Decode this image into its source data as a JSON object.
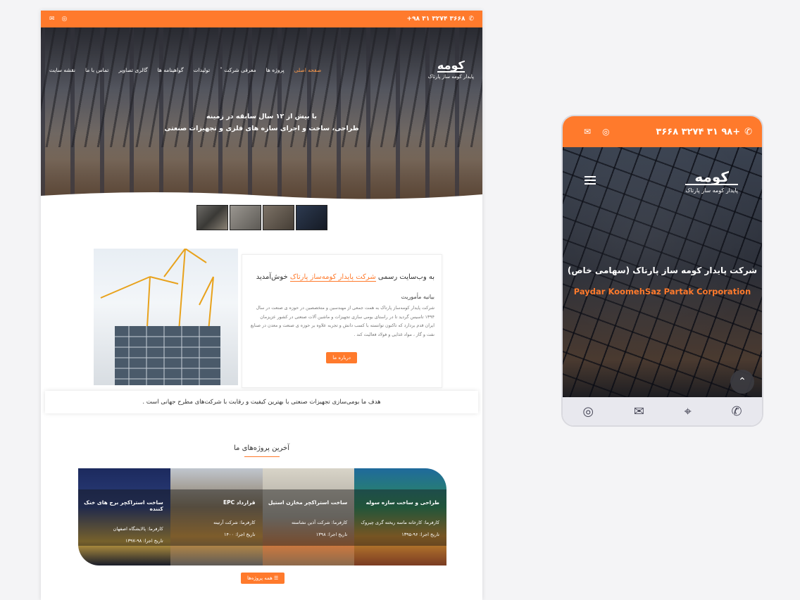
{
  "desktop": {
    "topbar": {
      "phone": "۳۶۶۸ ۳۲۷۴ ۳۱ ۹۸+"
    },
    "menu": [
      "صفحه اصلی",
      "پروژه ها",
      "معرفی شرکت ˅",
      "تولیدات",
      "گواهینامه ها",
      "گالری تصاویر",
      "تماس با ما",
      "نقشه سایت"
    ],
    "logo": {
      "mark": "کومه",
      "sub": "پایدار کومه ساز پارتاک"
    },
    "hero": {
      "line1": "با بیش از ۱۲ سال سابقه در زمینه",
      "line2": "طراحی، ساخت و اجرای سازه های فلزی و تجهیزات صنعتی"
    },
    "about": {
      "welcome_pre": "به وب‌سایت رسمی",
      "welcome_name": "شرکت پایدار کومه‌ساز پارتاک",
      "welcome_post": "خوش‌آمدید",
      "mission_title": "بیانیه مأموریت",
      "mission_text": "شرکت پایدار کومه‌ساز پارتاک به همت جمعی از مهندسین و متخصصین در حوزه ی صنعت در سال ۱۳۹۴ تاسیس گردید تا در راستای بومی سازی تجهیزات و ماشین آلات صنعتی در کشور عزیزمان ایران قدم بردارد که تاکنون توانسته با کسب دانش و تجربه علاوه بر حوزه ی صنعت و معدن در صنایع نفت و گاز ، مواد غذایی و فولاد فعالیت کند .",
      "button": "درباره ما"
    },
    "goal": "هدف ما بومی‌سازی تجهیزات صنعتی با بهترین کیفیت و رقابت با شرکت‌های مطرح جهانی است .",
    "projects_title": "آخرین پروژه‌های ما",
    "projects": [
      {
        "title": "طراحی و ساخت سازه سوله",
        "client": "کارفرما: کارخانه ماسه ریخته گری چیروک",
        "date": "تاریخ اجرا: ۹۶-۱۳۹۵"
      },
      {
        "title": "ساخت استراکچر مخازن استیل",
        "client": "کارفرما: شرکت آذین نشاسته",
        "date": "تاریخ اجرا: ۱۳۹۸"
      },
      {
        "title": "قرارداد EPC",
        "client": "کارفرما: شرکت آرتینه",
        "date": "تاریخ اجرا: ۱۴۰۰"
      },
      {
        "title": "ساخت استراکچر برج های خنک کننده",
        "client": "کارفرما: پالایشگاه اصفهان",
        "date": "تاریخ اجرا: ۹۸-۱۳۹۷"
      }
    ],
    "all_projects": "☰ همه پروژه‌ها"
  },
  "mobile": {
    "phone": "۳۶۶۸ ۳۲۷۴ ۳۱ ۹۸+",
    "logo": {
      "mark": "کومه",
      "sub": "پایدار کومه ساز پارتاک"
    },
    "heading_fa": "شرکت پایدار کومه ساز پارتاک (سهامی خاص)",
    "heading_en": "Paydar KoomehSaz Partak Corporation",
    "accent": "#ff7a2c"
  }
}
